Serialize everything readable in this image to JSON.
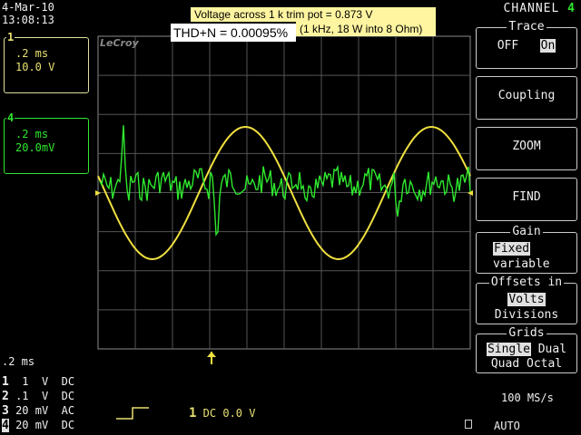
{
  "header": {
    "date": "4-Mar-10",
    "time": "13:08:13"
  },
  "channels_left": {
    "ch1": {
      "tag": "1",
      "timediv": ".2 ms",
      "voltdiv": "10.0 V"
    },
    "ch4": {
      "tag": "4",
      "timediv": ".2 ms",
      "voltdiv": "20.0mV"
    }
  },
  "brand": "LeCroy",
  "annotations": {
    "line1": "Voltage across 1 k trim pot = 0.873 V",
    "line2": "(1 kHz, 18 W into 8 Ohm)",
    "thd": "THD+N = 0.00095%"
  },
  "menu": {
    "title": "CHANNEL",
    "channel_num": "4",
    "trace": {
      "title": "Trace",
      "off": "OFF",
      "on": "On"
    },
    "coupling": "Coupling",
    "zoom": "ZOOM",
    "find": "FIND",
    "gain": {
      "title": "Gain",
      "fixed": "Fixed",
      "variable": "variable"
    },
    "offsets": {
      "title": "Offsets in",
      "volts": "Volts",
      "divisions": "Divisions"
    },
    "grids": {
      "title": "Grids",
      "single": "Single",
      "dual": "Dual",
      "quad": "Quad",
      "octal": "Octal"
    }
  },
  "bottom": {
    "timebase": ".2 ms",
    "rows": [
      {
        "num": "1",
        "value": " 1  V",
        "coupling": "DC"
      },
      {
        "num": "2",
        "value": ".1  V",
        "coupling": "DC"
      },
      {
        "num": "3",
        "value": "20 mV",
        "coupling": "AC"
      },
      {
        "num": "4",
        "value": "20 mV",
        "coupling": "DC"
      }
    ],
    "trigger_ch": "1",
    "trigger_text": "DC 0.0 V",
    "sample_rate": "100 MS/s",
    "mode": "AUTO"
  },
  "colors": {
    "ch1": "#f0e040",
    "ch4": "#2ee82e",
    "annotation_bg": "#fff5a0"
  }
}
